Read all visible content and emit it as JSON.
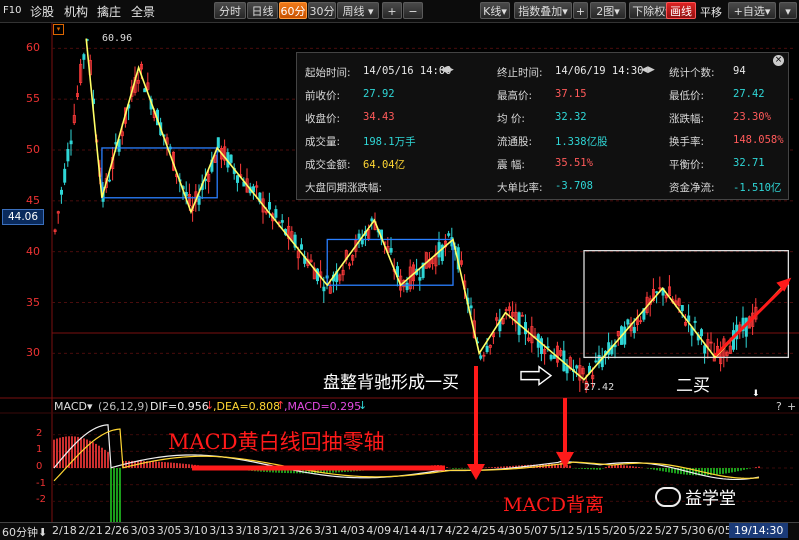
{
  "toolbar": {
    "left_items": [
      "F10",
      "诊股",
      "机构",
      "擒庄",
      "全景"
    ],
    "period_buttons": [
      "分时",
      "日线",
      "60分",
      "30分",
      "周线"
    ],
    "active_period": "60分",
    "zoom_in": "+",
    "zoom_out": "−",
    "kline_select": "K线",
    "overlay_select": "指数叠加",
    "overlay_add": "+",
    "layout_select": "2图",
    "rights_select": "下除权",
    "draw_button": "画线",
    "pan_button": "平移",
    "custom_button": "+自选"
  },
  "price_axis": {
    "ticks": [
      "60",
      "55",
      "50",
      "45",
      "40",
      "35",
      "30"
    ],
    "current_price": "44.06",
    "high_label": "60.96",
    "low_label": "27.42"
  },
  "macd": {
    "title": "MACD",
    "params": "(26,12,9)",
    "dif": "DIF=0.956",
    "dea": ",DEA=0.808",
    "macd": ",MACD=0.295",
    "axis_ticks": [
      "2",
      "1",
      "0",
      "-1",
      "-2"
    ],
    "help": "?",
    "plus": "+"
  },
  "stats": {
    "rows": [
      {
        "l1": "起始时间:",
        "v1": "14/05/16 14:00",
        "l2": "终止时间:",
        "v2": "14/06/19 14:30",
        "l3": "统计个数:",
        "v3": "94"
      },
      {
        "l1": "前收价:",
        "v1": "27.92",
        "l2": "最高价:",
        "v2": "37.15",
        "l3": "最低价:",
        "v3": "27.42"
      },
      {
        "l1": "收盘价:",
        "v1": "34.43",
        "l2": "均  价:",
        "v2": "32.32",
        "l3": "涨跌幅:",
        "v3": "23.30%"
      },
      {
        "l1": "成交量:",
        "v1": "198.1万手",
        "l2": "流通股:",
        "v2": "1.338亿股",
        "l3": "换手率:",
        "v3": "148.058%"
      },
      {
        "l1": "成交金额:",
        "v1": "64.04亿",
        "l2": "震  幅:",
        "v2": "35.51%",
        "l3": "平衡价:",
        "v3": "32.71"
      },
      {
        "l1": "大盘同期涨跌幅:",
        "v1": "",
        "l2": "大单比率:",
        "v2": "-3.708",
        "l3": "资金净流:",
        "v3": "-1.510亿"
      }
    ]
  },
  "annotations": {
    "divergence_text": "盘整背驰形成一买",
    "second_buy": "二买",
    "macd_pullback": "MACD黄白线回抽零轴",
    "macd_divergence": "MACD背离",
    "watermark": "益学堂"
  },
  "bottom_axis": {
    "period": "60分钟",
    "end_time": "19/14:30"
  },
  "colors": {
    "up": "#ff3b3b",
    "down": "#2fd6d6",
    "zigzag": "#ffff66",
    "box": "#2a7fff",
    "annotation_red": "#ff1a1a"
  },
  "chart_data": {
    "type": "candlestick",
    "y_range": [
      26,
      62
    ],
    "x_labels": [
      "2/18",
      "2/21",
      "2/26",
      "3/03",
      "3/05",
      "3/10",
      "3/13",
      "3/18",
      "3/21",
      "3/26",
      "3/31",
      "4/03",
      "4/09",
      "4/14",
      "4/17",
      "4/22",
      "4/25",
      "4/30",
      "5/07",
      "5/12",
      "5/15",
      "5/20",
      "5/22",
      "5/27",
      "5/30",
      "6/05",
      "6/10"
    ],
    "zigzag_prices": [
      60.96,
      45.3,
      58.1,
      43.9,
      50.2,
      36.7,
      43.1,
      36.7,
      41.2,
      30.0,
      34.0,
      27.42,
      36.4,
      29.6,
      37.15
    ],
    "zigzag_dates": [
      "2/21",
      "2/24",
      "3/03",
      "3/10",
      "3/13",
      "4/01",
      "4/09",
      "4/14",
      "4/22",
      "4/25",
      "4/30",
      "5/15",
      "5/27",
      "6/05",
      "6/19"
    ],
    "macd_range": [
      -3,
      3
    ]
  }
}
